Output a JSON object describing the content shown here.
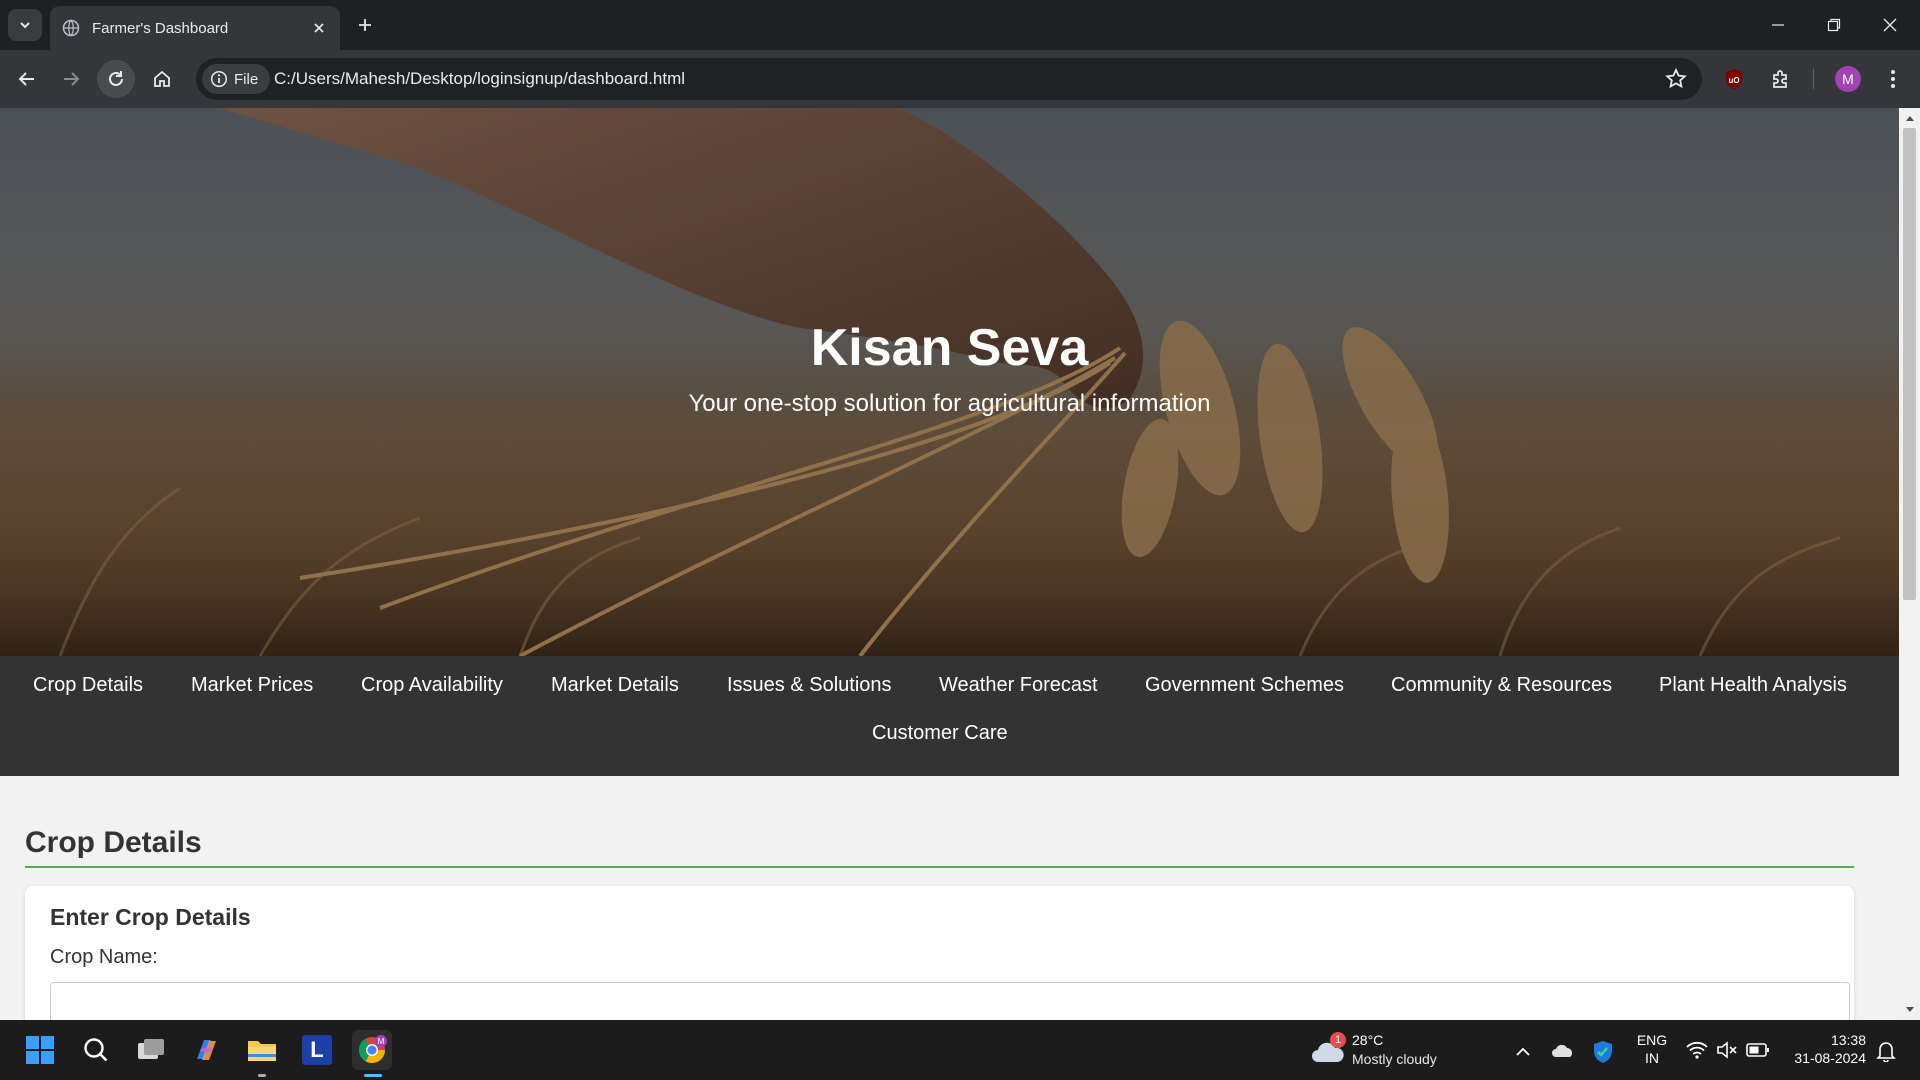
{
  "browser": {
    "tab_title": "Farmer's Dashboard",
    "security_chip": "File",
    "url": "C:/Users/Mahesh/Desktop/loginsignup/dashboard.html",
    "profile_initial": "M"
  },
  "hero": {
    "title": "Kisan Seva",
    "subtitle": "Your one-stop solution for agricultural information"
  },
  "nav": {
    "items": [
      "Crop Details",
      "Market Prices",
      "Crop Availability",
      "Market Details",
      "Issues & Solutions",
      "Weather Forecast",
      "Government Schemes",
      "Community & Resources",
      "Plant Health Analysis",
      "Customer Care"
    ]
  },
  "main": {
    "section_title": "Crop Details",
    "card": {
      "heading": "Enter Crop Details",
      "crop_name_label": "Crop Name:"
    }
  },
  "taskbar": {
    "weather_badge": "1",
    "weather_temp": "28°C",
    "weather_desc": "Mostly cloudy",
    "lang_top": "ENG",
    "lang_bottom": "IN",
    "time": "13:38",
    "date": "31-08-2024",
    "app_letter": "L"
  },
  "colors": {
    "nav_bg": "#333333",
    "accent_green": "#4caf50",
    "page_bg": "#f2f2f2"
  }
}
